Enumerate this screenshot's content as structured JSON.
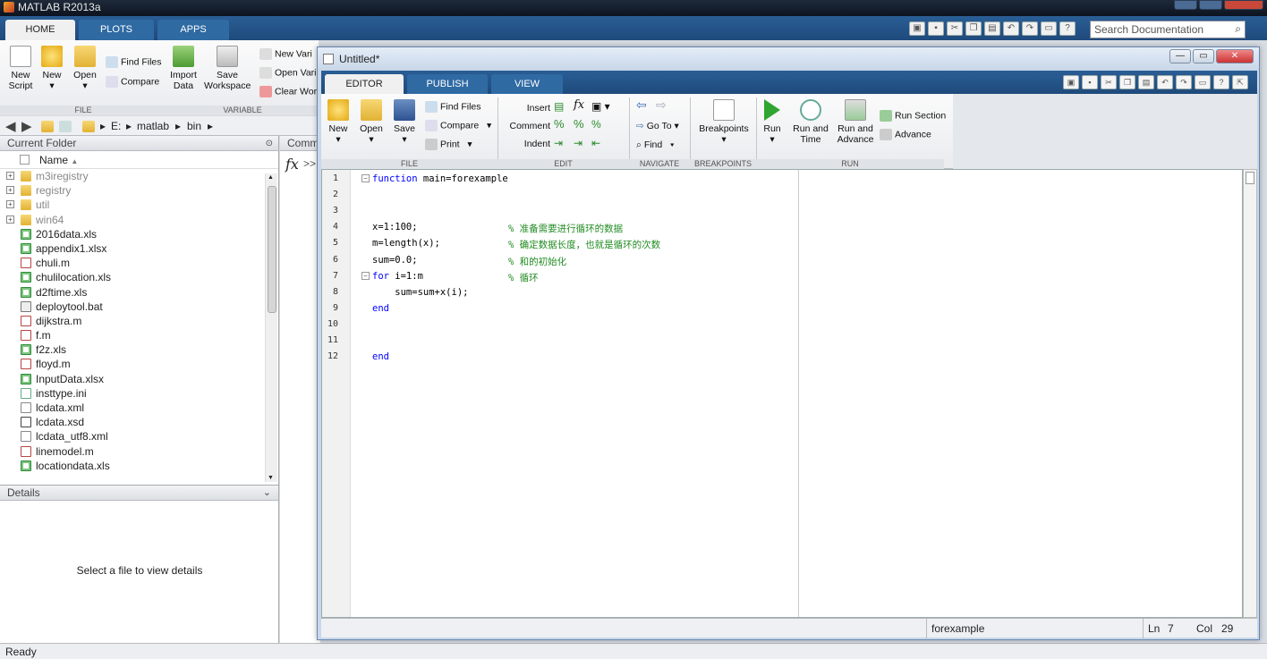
{
  "app": {
    "title": "MATLAB R2013a",
    "tabs": [
      "HOME",
      "PLOTS",
      "APPS"
    ],
    "search_placeholder": "Search Documentation",
    "status": "Ready"
  },
  "home_ribbon": {
    "new_script": "New\nScript",
    "new_line1": "New",
    "new_line2": "Script",
    "new": "New",
    "open": "Open",
    "find_files": "Find Files",
    "compare": "Compare",
    "import_data_1": "Import",
    "import_data_2": "Data",
    "save_ws_1": "Save",
    "save_ws_2": "Workspace",
    "new_variable": "New Vari",
    "open_variable": "Open Vari",
    "clear_workspace": "Clear Wor",
    "group_file": "FILE",
    "group_variable": "VARIABLE"
  },
  "address": {
    "path": [
      "E:",
      "matlab",
      "bin"
    ]
  },
  "current_folder": {
    "title": "Current Folder",
    "column_name": "Name",
    "items": [
      {
        "name": "m3iregistry",
        "type": "folder"
      },
      {
        "name": "registry",
        "type": "folder"
      },
      {
        "name": "util",
        "type": "folder"
      },
      {
        "name": "win64",
        "type": "folder"
      },
      {
        "name": "2016data.xls",
        "type": "xls"
      },
      {
        "name": "appendix1.xlsx",
        "type": "xls"
      },
      {
        "name": "chuli.m",
        "type": "m"
      },
      {
        "name": "chulilocation.xls",
        "type": "xls"
      },
      {
        "name": "d2ftime.xls",
        "type": "xls"
      },
      {
        "name": "deploytool.bat",
        "type": "bat"
      },
      {
        "name": "dijkstra.m",
        "type": "m"
      },
      {
        "name": "f.m",
        "type": "m"
      },
      {
        "name": "f2z.xls",
        "type": "xls"
      },
      {
        "name": "floyd.m",
        "type": "m"
      },
      {
        "name": "InputData.xlsx",
        "type": "xls"
      },
      {
        "name": "insttype.ini",
        "type": "ini"
      },
      {
        "name": "lcdata.xml",
        "type": "xml"
      },
      {
        "name": "lcdata.xsd",
        "type": "xsd"
      },
      {
        "name": "lcdata_utf8.xml",
        "type": "xml"
      },
      {
        "name": "linemodel.m",
        "type": "m"
      },
      {
        "name": "locationdata.xls",
        "type": "xls"
      }
    ]
  },
  "details": {
    "title": "Details",
    "message": "Select a file to view details"
  },
  "command_window": {
    "title": "Comm",
    "prompt": ">>"
  },
  "editor": {
    "title": "Untitled*",
    "tabs": [
      "EDITOR",
      "PUBLISH",
      "VIEW"
    ],
    "ribbon": {
      "new": "New",
      "open": "Open",
      "save": "Save",
      "find_files": "Find Files",
      "compare": "Compare",
      "print": "Print",
      "insert": "Insert",
      "comment": "Comment",
      "indent": "Indent",
      "go_to": "Go To",
      "find": "Find",
      "breakpoints": "Breakpoints",
      "run": "Run",
      "run_and_time_1": "Run and",
      "run_and_time_2": "Time",
      "run_and_advance_1": "Run and",
      "run_and_advance_2": "Advance",
      "run_section": "Run Section",
      "advance": "Advance",
      "groups": [
        "FILE",
        "EDIT",
        "NAVIGATE",
        "BREAKPOINTS",
        "RUN"
      ]
    },
    "code_lines": [
      {
        "n": "1",
        "code": "function main=forexample",
        "comment": ""
      },
      {
        "n": "2",
        "code": "",
        "comment": ""
      },
      {
        "n": "3",
        "code": "",
        "comment": ""
      },
      {
        "n": "4",
        "code": "x=1:100;",
        "comment": "% 准备需要进行循环的数据"
      },
      {
        "n": "5",
        "code": "m=length(x);",
        "comment": "% 确定数据长度，也就是循环的次数"
      },
      {
        "n": "6",
        "code": "sum=0.0;",
        "comment": "% 和的初始化"
      },
      {
        "n": "7",
        "code": "for i=1:m",
        "comment": "% 循环"
      },
      {
        "n": "8",
        "code": "    sum=sum+x(i);",
        "comment": ""
      },
      {
        "n": "9",
        "code": "end",
        "comment": ""
      },
      {
        "n": "10",
        "code": "",
        "comment": ""
      },
      {
        "n": "11",
        "code": "",
        "comment": ""
      },
      {
        "n": "12",
        "code": "end",
        "comment": ""
      }
    ],
    "status": {
      "function_name": "forexample",
      "ln_label": "Ln",
      "ln_value": "7",
      "col_label": "Col",
      "col_value": "29"
    }
  },
  "colors": {
    "ribbon_tab_bg": "#1f4a7c",
    "keyword": "#0000ff",
    "comment": "#228b22"
  }
}
